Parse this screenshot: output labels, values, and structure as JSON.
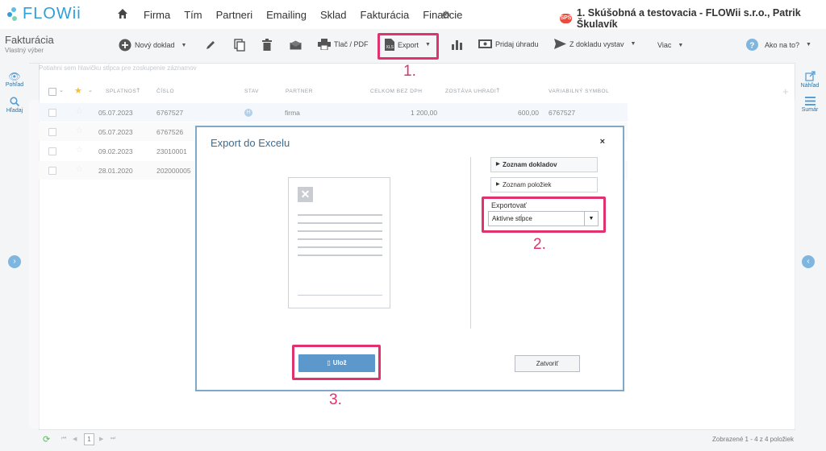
{
  "app": {
    "name": "FLOWii"
  },
  "topnav": {
    "items": [
      "Firma",
      "Tím",
      "Partneri",
      "Emailing",
      "Sklad",
      "Fakturácia",
      "Financie"
    ]
  },
  "company": {
    "badge": "SPS",
    "name": "1. Skúšobná a testovacia - FLOWii s.r.o., Patrik Škulavík"
  },
  "page": {
    "title": "Fakturácia",
    "subtitle": "Vlastný výber"
  },
  "toolbar": {
    "new_document": "Nový doklad",
    "print": "Tlač / PDF",
    "export": "Export",
    "add_payment": "Pridaj úhradu",
    "issue_from": "Z dokladu vystav",
    "more": "Viac",
    "help": "Ako na to?"
  },
  "left_sidebar": {
    "view": "Pohľad",
    "search": "Hľadaj"
  },
  "right_sidebar": {
    "preview": "Náhľad",
    "summary": "Sumár"
  },
  "table": {
    "group_hint": "Potiahni sem hlavičku stĺpca pre zoskupenie záznamov",
    "columns": [
      "SPLATNOSŤ",
      "ČÍSLO",
      "STAV",
      "PARTNER",
      "CELKOM BEZ DPH",
      "ZOSTÁVA UHRADIŤ",
      "VARIABILNÝ SYMBOL"
    ],
    "rows": [
      {
        "due": "05.07.2023",
        "number": "6767527",
        "status": "H",
        "partner": "firma",
        "total": "1 200,00",
        "remaining": "600,00",
        "vs": "6767527"
      },
      {
        "due": "05.07.2023",
        "number": "6767526"
      },
      {
        "due": "09.02.2023",
        "number": "23010001"
      },
      {
        "due": "28.01.2020",
        "number": "202000005"
      }
    ]
  },
  "pagination": {
    "page": "1",
    "summary": "Zobrazené 1 - 4 z 4 položiek"
  },
  "modal": {
    "title": "Export do Excelu",
    "close": "×",
    "doc_list": "Zoznam dokladov",
    "item_list": "Zoznam položiek",
    "export_label": "Exportovať",
    "export_value": "Aktívne stĺpce",
    "save": "Ulož",
    "close_button": "Zatvoriť"
  },
  "annotations": {
    "step1": "1.",
    "step2": "2.",
    "step3": "3."
  },
  "colors": {
    "accent": "#2f9fd8",
    "highlight": "#e0326e",
    "save": "#5d98cc"
  }
}
